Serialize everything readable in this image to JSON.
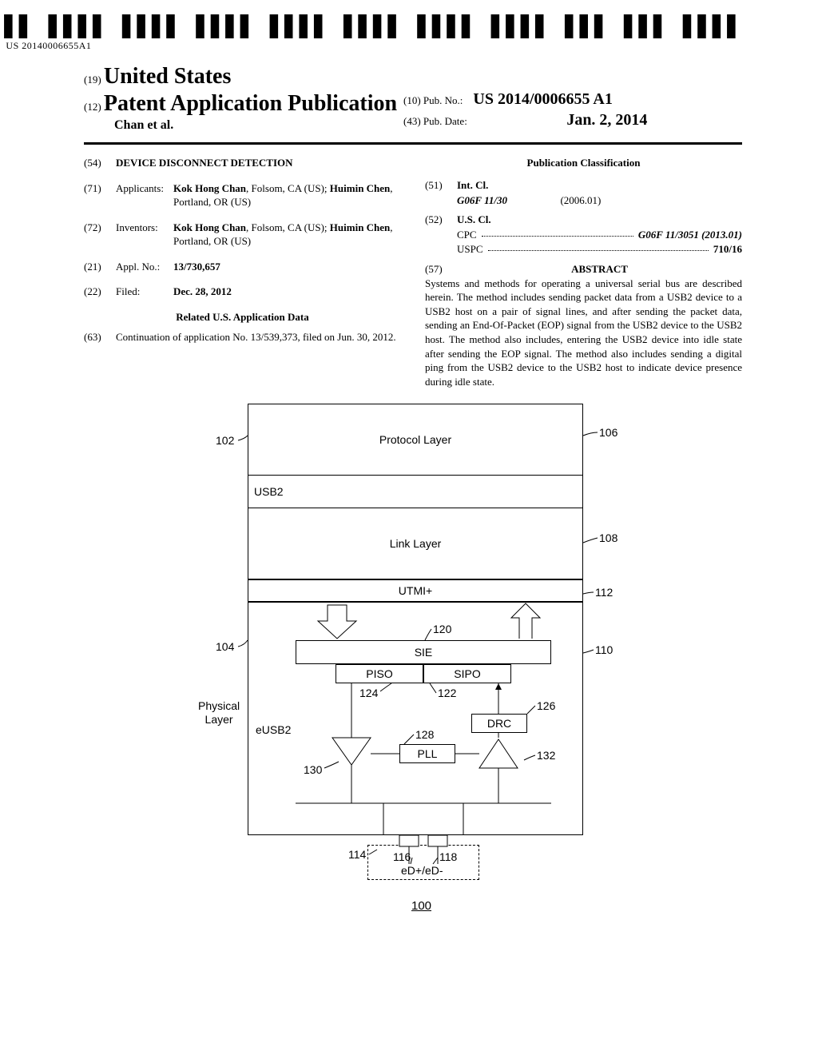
{
  "barcode": {
    "number": "US 20140006655A1"
  },
  "header": {
    "country_code": "(19)",
    "country": "United States",
    "pub_code": "(12)",
    "pub_type": "Patent Application Publication",
    "authors": "Chan et al.",
    "pubno_code": "(10)",
    "pubno_label": "Pub. No.:",
    "pubno": "US 2014/0006655 A1",
    "pubdate_code": "(43)",
    "pubdate_label": "Pub. Date:",
    "pubdate": "Jan. 2, 2014"
  },
  "left": {
    "title_code": "(54)",
    "title": "DEVICE DISCONNECT DETECTION",
    "applicants_code": "(71)",
    "applicants_label": "Applicants:",
    "applicants": "Kok Hong Chan, Folsom, CA (US); Huimin Chen, Portland, OR (US)",
    "inventors_code": "(72)",
    "inventors_label": "Inventors:",
    "inventors": "Kok Hong Chan, Folsom, CA (US); Huimin Chen, Portland, OR (US)",
    "applno_code": "(21)",
    "applno_label": "Appl. No.:",
    "applno": "13/730,657",
    "filed_code": "(22)",
    "filed_label": "Filed:",
    "filed": "Dec. 28, 2012",
    "related_heading": "Related U.S. Application Data",
    "related_code": "(63)",
    "related_text": "Continuation of application No. 13/539,373, filed on Jun. 30, 2012."
  },
  "right": {
    "classif_heading": "Publication Classification",
    "intcl_code": "(51)",
    "intcl_label": "Int. Cl.",
    "intcl_class": "G06F 11/30",
    "intcl_year": "(2006.01)",
    "uscl_code": "(52)",
    "uscl_label": "U.S. Cl.",
    "cpc_label": "CPC",
    "cpc_value": "G06F 11/3051 (2013.01)",
    "uspc_label": "USPC",
    "uspc_value": "710/16",
    "abstract_code": "(57)",
    "abstract_heading": "ABSTRACT",
    "abstract_text": "Systems and methods for operating a universal serial bus are described herein. The method includes sending packet data from a USB2 device to a USB2 host on a pair of signal lines, and after sending the packet data, sending an End-Of-Packet (EOP) signal from the USB2 device to the USB2 host. The method also includes, entering the USB2 device into idle state after sending the EOP signal. The method also includes sending a digital ping from the USB2 device to the USB2 host to indicate device presence during idle state."
  },
  "diagram": {
    "ref102": "102",
    "ref104": "104",
    "ref106": "106",
    "ref108": "108",
    "ref110": "110",
    "ref112": "112",
    "ref114": "114",
    "ref116": "116",
    "ref118": "118",
    "ref120": "120",
    "ref122": "122",
    "ref124": "124",
    "ref126": "126",
    "ref128": "128",
    "ref130": "130",
    "ref132": "132",
    "usb2": "USB2",
    "eusb2": "eUSB2",
    "phys": "Physical Layer",
    "protocol": "Protocol Layer",
    "link": "Link Layer",
    "utmi": "UTMI+",
    "sie": "SIE",
    "piso": "PISO",
    "sipo": "SIPO",
    "drc": "DRC",
    "pll": "PLL",
    "edp": "eD+/eD-",
    "fignum": "100"
  }
}
